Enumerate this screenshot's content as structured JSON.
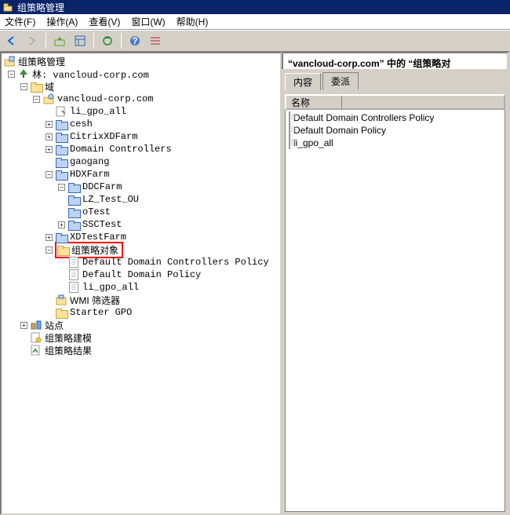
{
  "titlebar": {
    "text": "组策略管理"
  },
  "menu": {
    "file": "文件(F)",
    "action": "操作(A)",
    "view": "查看(V)",
    "window": "窗口(W)",
    "help": "帮助(H)"
  },
  "tree": {
    "root": "组策略管理",
    "forest": "林: vancloud-corp.com",
    "domains": "域",
    "domain": "vancloud-corp.com",
    "li_gpo_all": "li_gpo_all",
    "cesh": "cesh",
    "citrix": "CitrixXDFarm",
    "dc": "Domain Controllers",
    "gaogang": "gaogang",
    "hdx": "HDXFarm",
    "ddc": "DDCFarm",
    "lz": "LZ_Test_OU",
    "otest": "oTest",
    "ssc": "SSCTest",
    "xdtest": "XDTestFarm",
    "gpobj": "组策略对象",
    "ddcp": "Default Domain Controllers Policy",
    "ddp": "Default Domain Policy",
    "lga": "li_gpo_all",
    "wmi": "WMI 筛选器",
    "starter": "Starter GPO",
    "sites": "站点",
    "modeling": "组策略建模",
    "results": "组策略结果"
  },
  "right": {
    "title": "“vancloud-corp.com” 中的 “组策略对",
    "tab_content": "内容",
    "tab_delegate": "委派",
    "col_name": "名称",
    "items": {
      "0": "Default Domain Controllers Policy",
      "1": "Default Domain Policy",
      "2": "li_gpo_all"
    }
  }
}
